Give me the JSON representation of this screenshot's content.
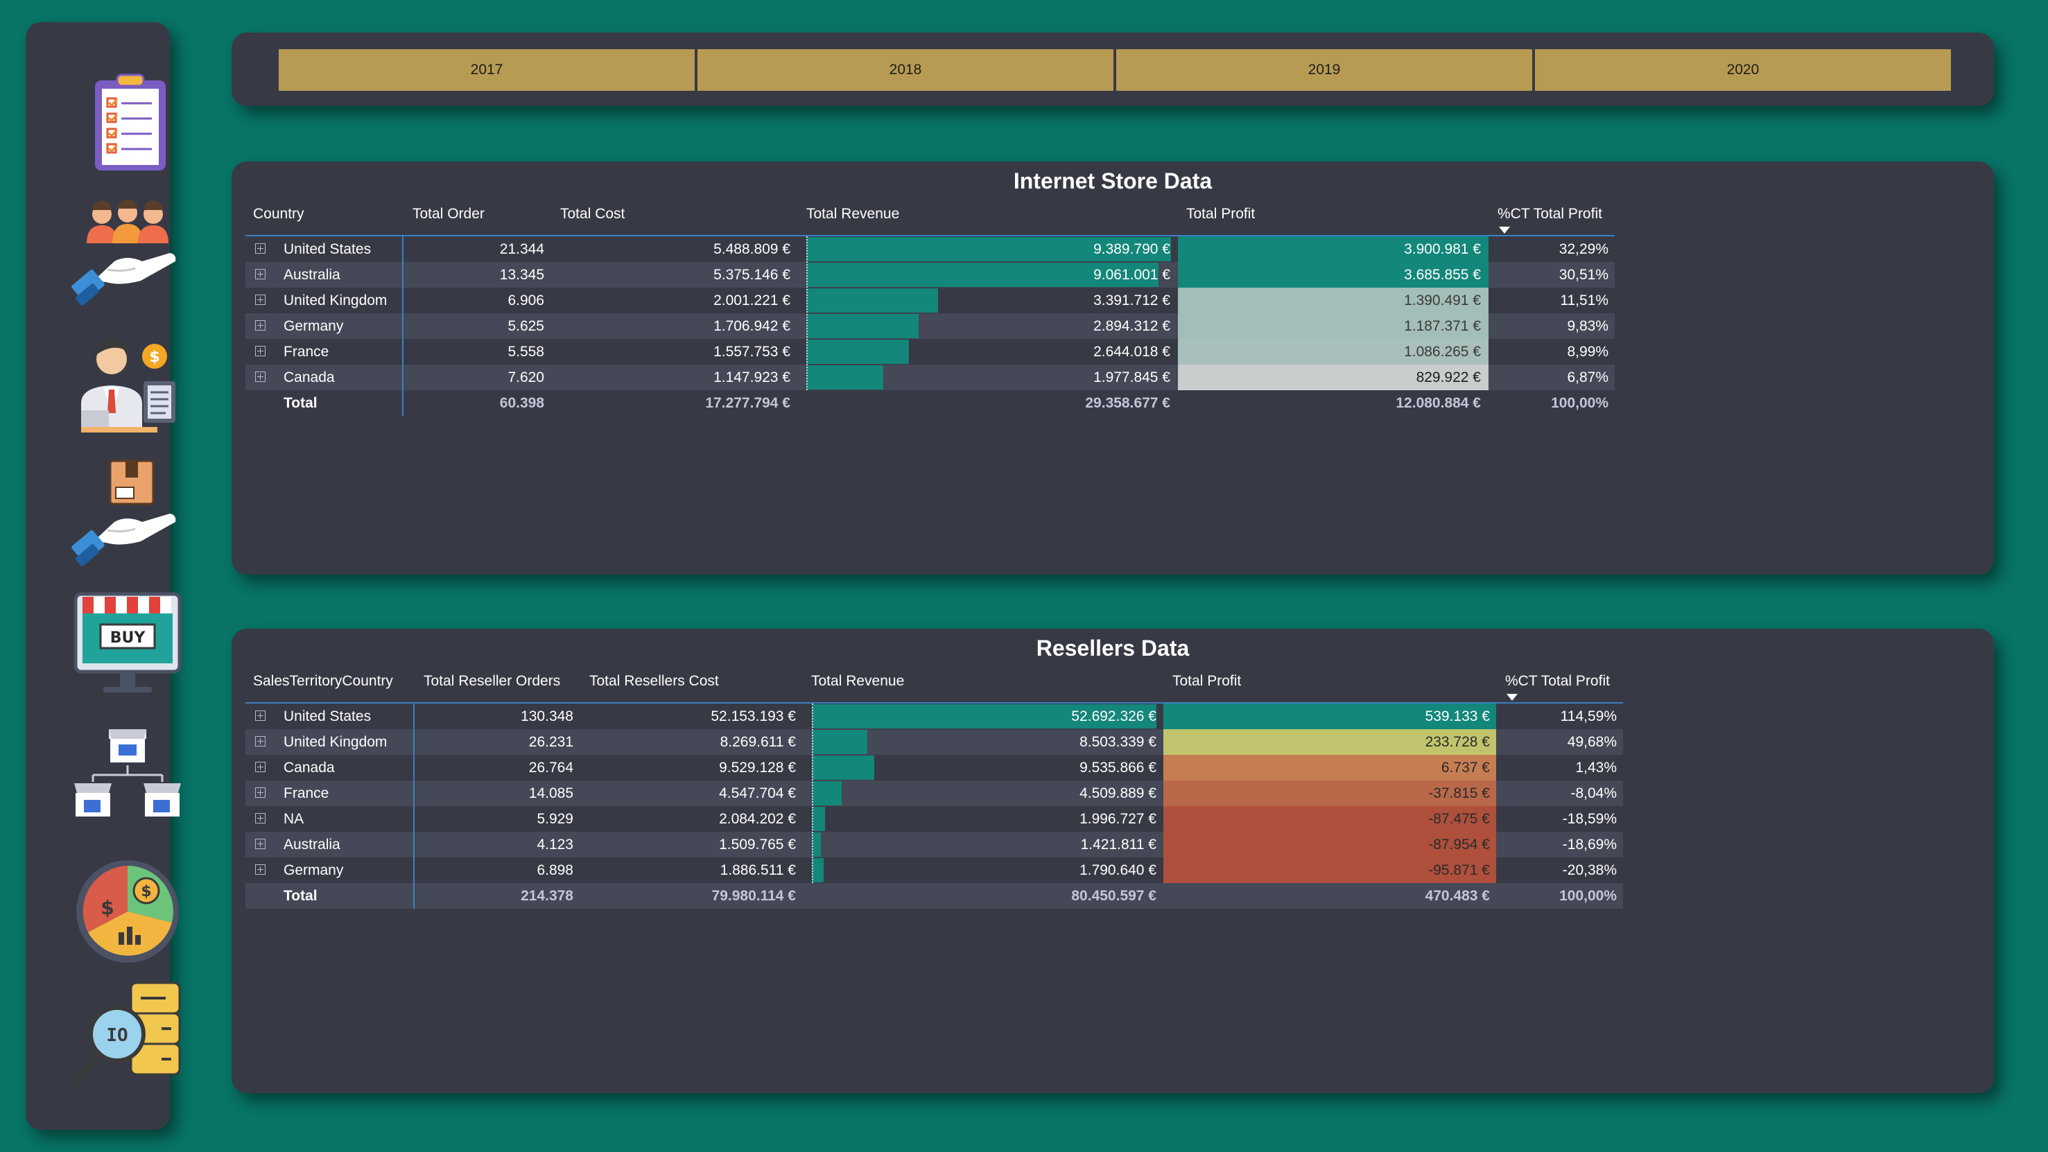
{
  "nav": [
    {
      "icon": "checklist-icon"
    },
    {
      "icon": "customers-hand-icon"
    },
    {
      "icon": "salesperson-icon"
    },
    {
      "icon": "product-hand-icon"
    },
    {
      "icon": "online-store-icon"
    },
    {
      "icon": "resellers-stores-icon"
    },
    {
      "icon": "finance-pie-chart-icon"
    },
    {
      "icon": "data-search-icon"
    }
  ],
  "years": [
    "2017",
    "2018",
    "2019",
    "2020"
  ],
  "internet": {
    "title": "Internet Store Data",
    "headers": [
      "Country",
      "Total Order",
      "Total Cost",
      "Total Revenue",
      "Total Profit",
      "%CT Total Profit"
    ],
    "rows": [
      [
        "United States",
        "21.344",
        "5.488.809 €",
        "9.389.790 €",
        "3.900.981 €",
        "32,29%"
      ],
      [
        "Australia",
        "13.345",
        "5.375.146 €",
        "9.061.001 €",
        "3.685.855 €",
        "30,51%"
      ],
      [
        "United Kingdom",
        "6.906",
        "2.001.221 €",
        "3.391.712 €",
        "1.390.491 €",
        "11,51%"
      ],
      [
        "Germany",
        "5.625",
        "1.706.942 €",
        "2.894.312 €",
        "1.187.371 €",
        "9,83%"
      ],
      [
        "France",
        "5.558",
        "1.557.753 €",
        "2.644.018 €",
        "1.086.265 €",
        "8,99%"
      ],
      [
        "Canada",
        "7.620",
        "1.147.923 €",
        "1.977.845 €",
        "829.922 €",
        "6,87%"
      ]
    ],
    "total": [
      "Total",
      "60.398",
      "17.277.794 €",
      "29.358.677 €",
      "12.080.884 €",
      "100,00%"
    ],
    "revenue_values": [
      9389790,
      9061001,
      3391712,
      2894312,
      2644018,
      1977845
    ],
    "profit_colors": [
      "#13877a",
      "#13877a",
      "#a3bdb8",
      "#a3bdb8",
      "#a9bfbb",
      "#c9cdce"
    ],
    "profit_text_colors": [
      "#ffffff",
      "#ffffff",
      "#3a3a3a",
      "#3a3a3a",
      "#3a3a3a",
      "#1c1c1c"
    ]
  },
  "resellers": {
    "title": "Resellers Data",
    "headers": [
      "SalesTerritoryCountry",
      "Total Reseller Orders",
      "Total Resellers Cost",
      "Total Revenue",
      "Total Profit",
      "%CT Total Profit"
    ],
    "rows": [
      [
        "United States",
        "130.348",
        "52.153.193 €",
        "52.692.326 €",
        "539.133 €",
        "114,59%"
      ],
      [
        "United Kingdom",
        "26.231",
        "8.269.611 €",
        "8.503.339 €",
        "233.728 €",
        "49,68%"
      ],
      [
        "Canada",
        "26.764",
        "9.529.128 €",
        "9.535.866 €",
        "6.737 €",
        "1,43%"
      ],
      [
        "France",
        "14.085",
        "4.547.704 €",
        "4.509.889 €",
        "-37.815 €",
        "-8,04%"
      ],
      [
        "NA",
        "5.929",
        "2.084.202 €",
        "1.996.727 €",
        "-87.475 €",
        "-18,59%"
      ],
      [
        "Australia",
        "4.123",
        "1.509.765 €",
        "1.421.811 €",
        "-87.954 €",
        "-18,69%"
      ],
      [
        "Germany",
        "6.898",
        "1.886.511 €",
        "1.790.640 €",
        "-95.871 €",
        "-20,38%"
      ]
    ],
    "total": [
      "Total",
      "214.378",
      "79.980.114 €",
      "80.450.597 €",
      "470.483 €",
      "100,00%"
    ],
    "revenue_values": [
      52692326,
      8503339,
      9535866,
      4509889,
      1996727,
      1421811,
      1790640
    ],
    "profit_colors": [
      "#13877a",
      "#c2c46d",
      "#c67d52",
      "#b9694a",
      "#ae503b",
      "#ae503b",
      "#ae503b"
    ],
    "profit_text_colors": [
      "#ffffff",
      "#2a2a2a",
      "#2a2a2a",
      "#2a2a2a",
      "#2a2a2a",
      "#2a2a2a",
      "#2a2a2a"
    ]
  }
}
